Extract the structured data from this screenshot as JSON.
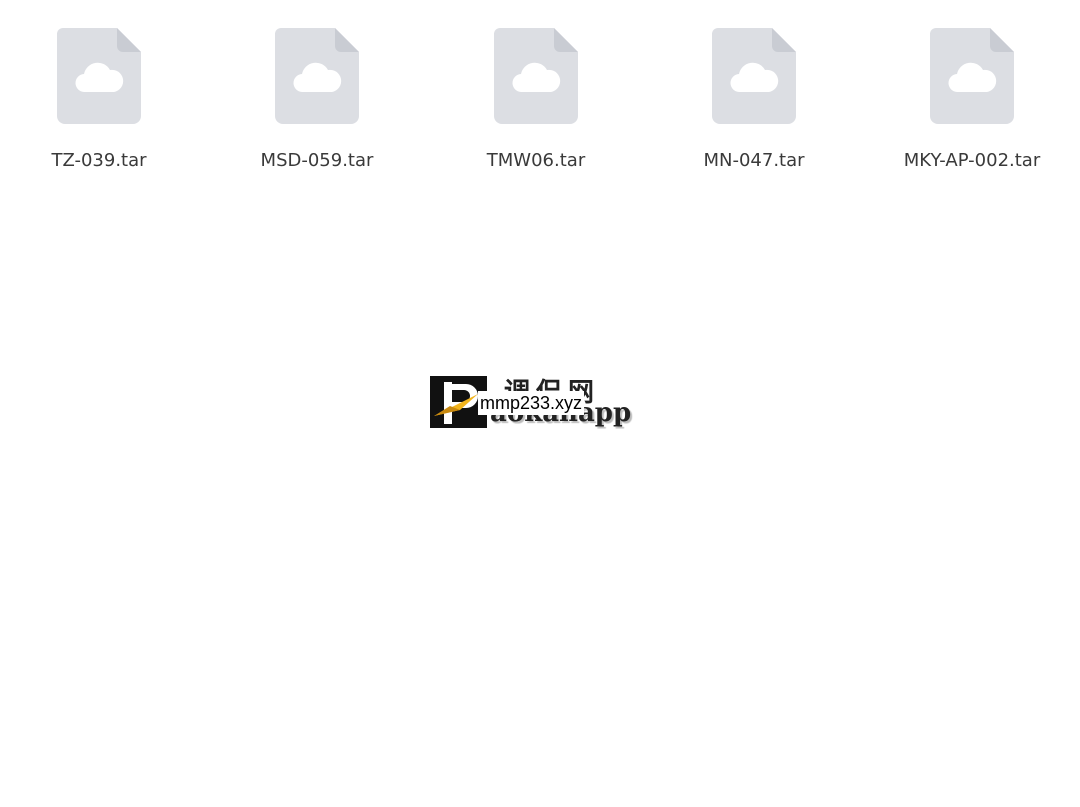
{
  "files": [
    {
      "name": "TZ-039.tar",
      "icon": "cloud-file-icon"
    },
    {
      "name": "MSD-059.tar",
      "icon": "cloud-file-icon"
    },
    {
      "name": "TMW06.tar",
      "icon": "cloud-file-icon"
    },
    {
      "name": "MN-047.tar",
      "icon": "cloud-file-icon"
    },
    {
      "name": "MKY-AP-002.tar",
      "icon": "cloud-file-icon"
    }
  ],
  "watermark": {
    "cjk_text": "调侃网",
    "latin_text": "aokanapp",
    "badge_text": "mmp233.xyz"
  },
  "colors": {
    "file_icon_fill": "#dcdee3",
    "file_icon_fold": "#c9ccd3",
    "cloud": "#ffffff",
    "file_name_text": "#3a3a3a",
    "logo_bg": "#111111",
    "logo_arrow": "#f2b51e"
  }
}
